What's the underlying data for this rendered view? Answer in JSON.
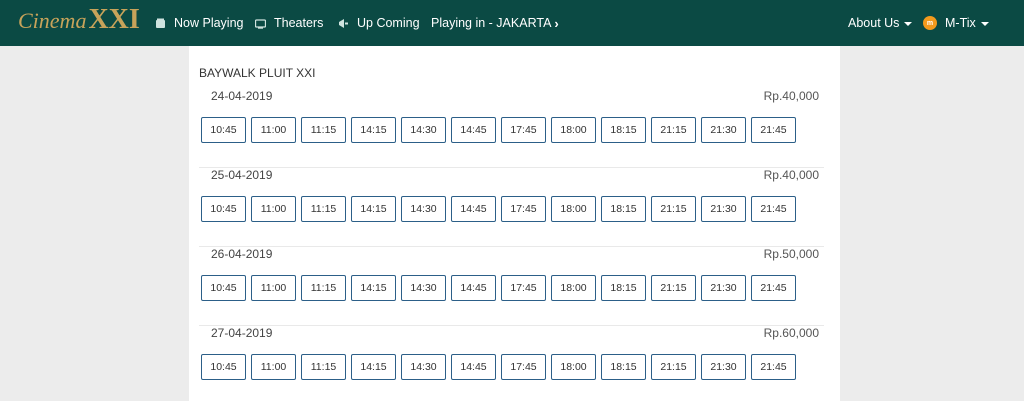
{
  "nav": {
    "logo_cinema": "Cinema",
    "logo_xxi": "XXI",
    "now_playing": "Now Playing",
    "theaters": "Theaters",
    "up_coming": "Up Coming",
    "playing_in": "Playing in - JAKARTA",
    "about_us": "About Us",
    "mtix": "M-Tix"
  },
  "theater": {
    "name": "BAYWALK PLUIT XXI",
    "days": [
      {
        "date": "24-04-2019",
        "price": "Rp.40,000",
        "times": [
          "10:45",
          "11:00",
          "11:15",
          "14:15",
          "14:30",
          "14:45",
          "17:45",
          "18:00",
          "18:15",
          "21:15",
          "21:30",
          "21:45"
        ]
      },
      {
        "date": "25-04-2019",
        "price": "Rp.40,000",
        "times": [
          "10:45",
          "11:00",
          "11:15",
          "14:15",
          "14:30",
          "14:45",
          "17:45",
          "18:00",
          "18:15",
          "21:15",
          "21:30",
          "21:45"
        ]
      },
      {
        "date": "26-04-2019",
        "price": "Rp.50,000",
        "times": [
          "10:45",
          "11:00",
          "11:15",
          "14:15",
          "14:30",
          "14:45",
          "17:45",
          "18:00",
          "18:15",
          "21:15",
          "21:30",
          "21:45"
        ]
      },
      {
        "date": "27-04-2019",
        "price": "Rp.60,000",
        "times": [
          "10:45",
          "11:00",
          "11:15",
          "14:15",
          "14:30",
          "14:45",
          "17:45",
          "18:00",
          "18:15",
          "21:15",
          "21:30",
          "21:45"
        ]
      }
    ]
  },
  "colors": {
    "navbar": "#0b4a44",
    "logo_gold": "#c7a35a",
    "button_border": "#2c5f88",
    "mtix_orange": "#f39a1d"
  }
}
